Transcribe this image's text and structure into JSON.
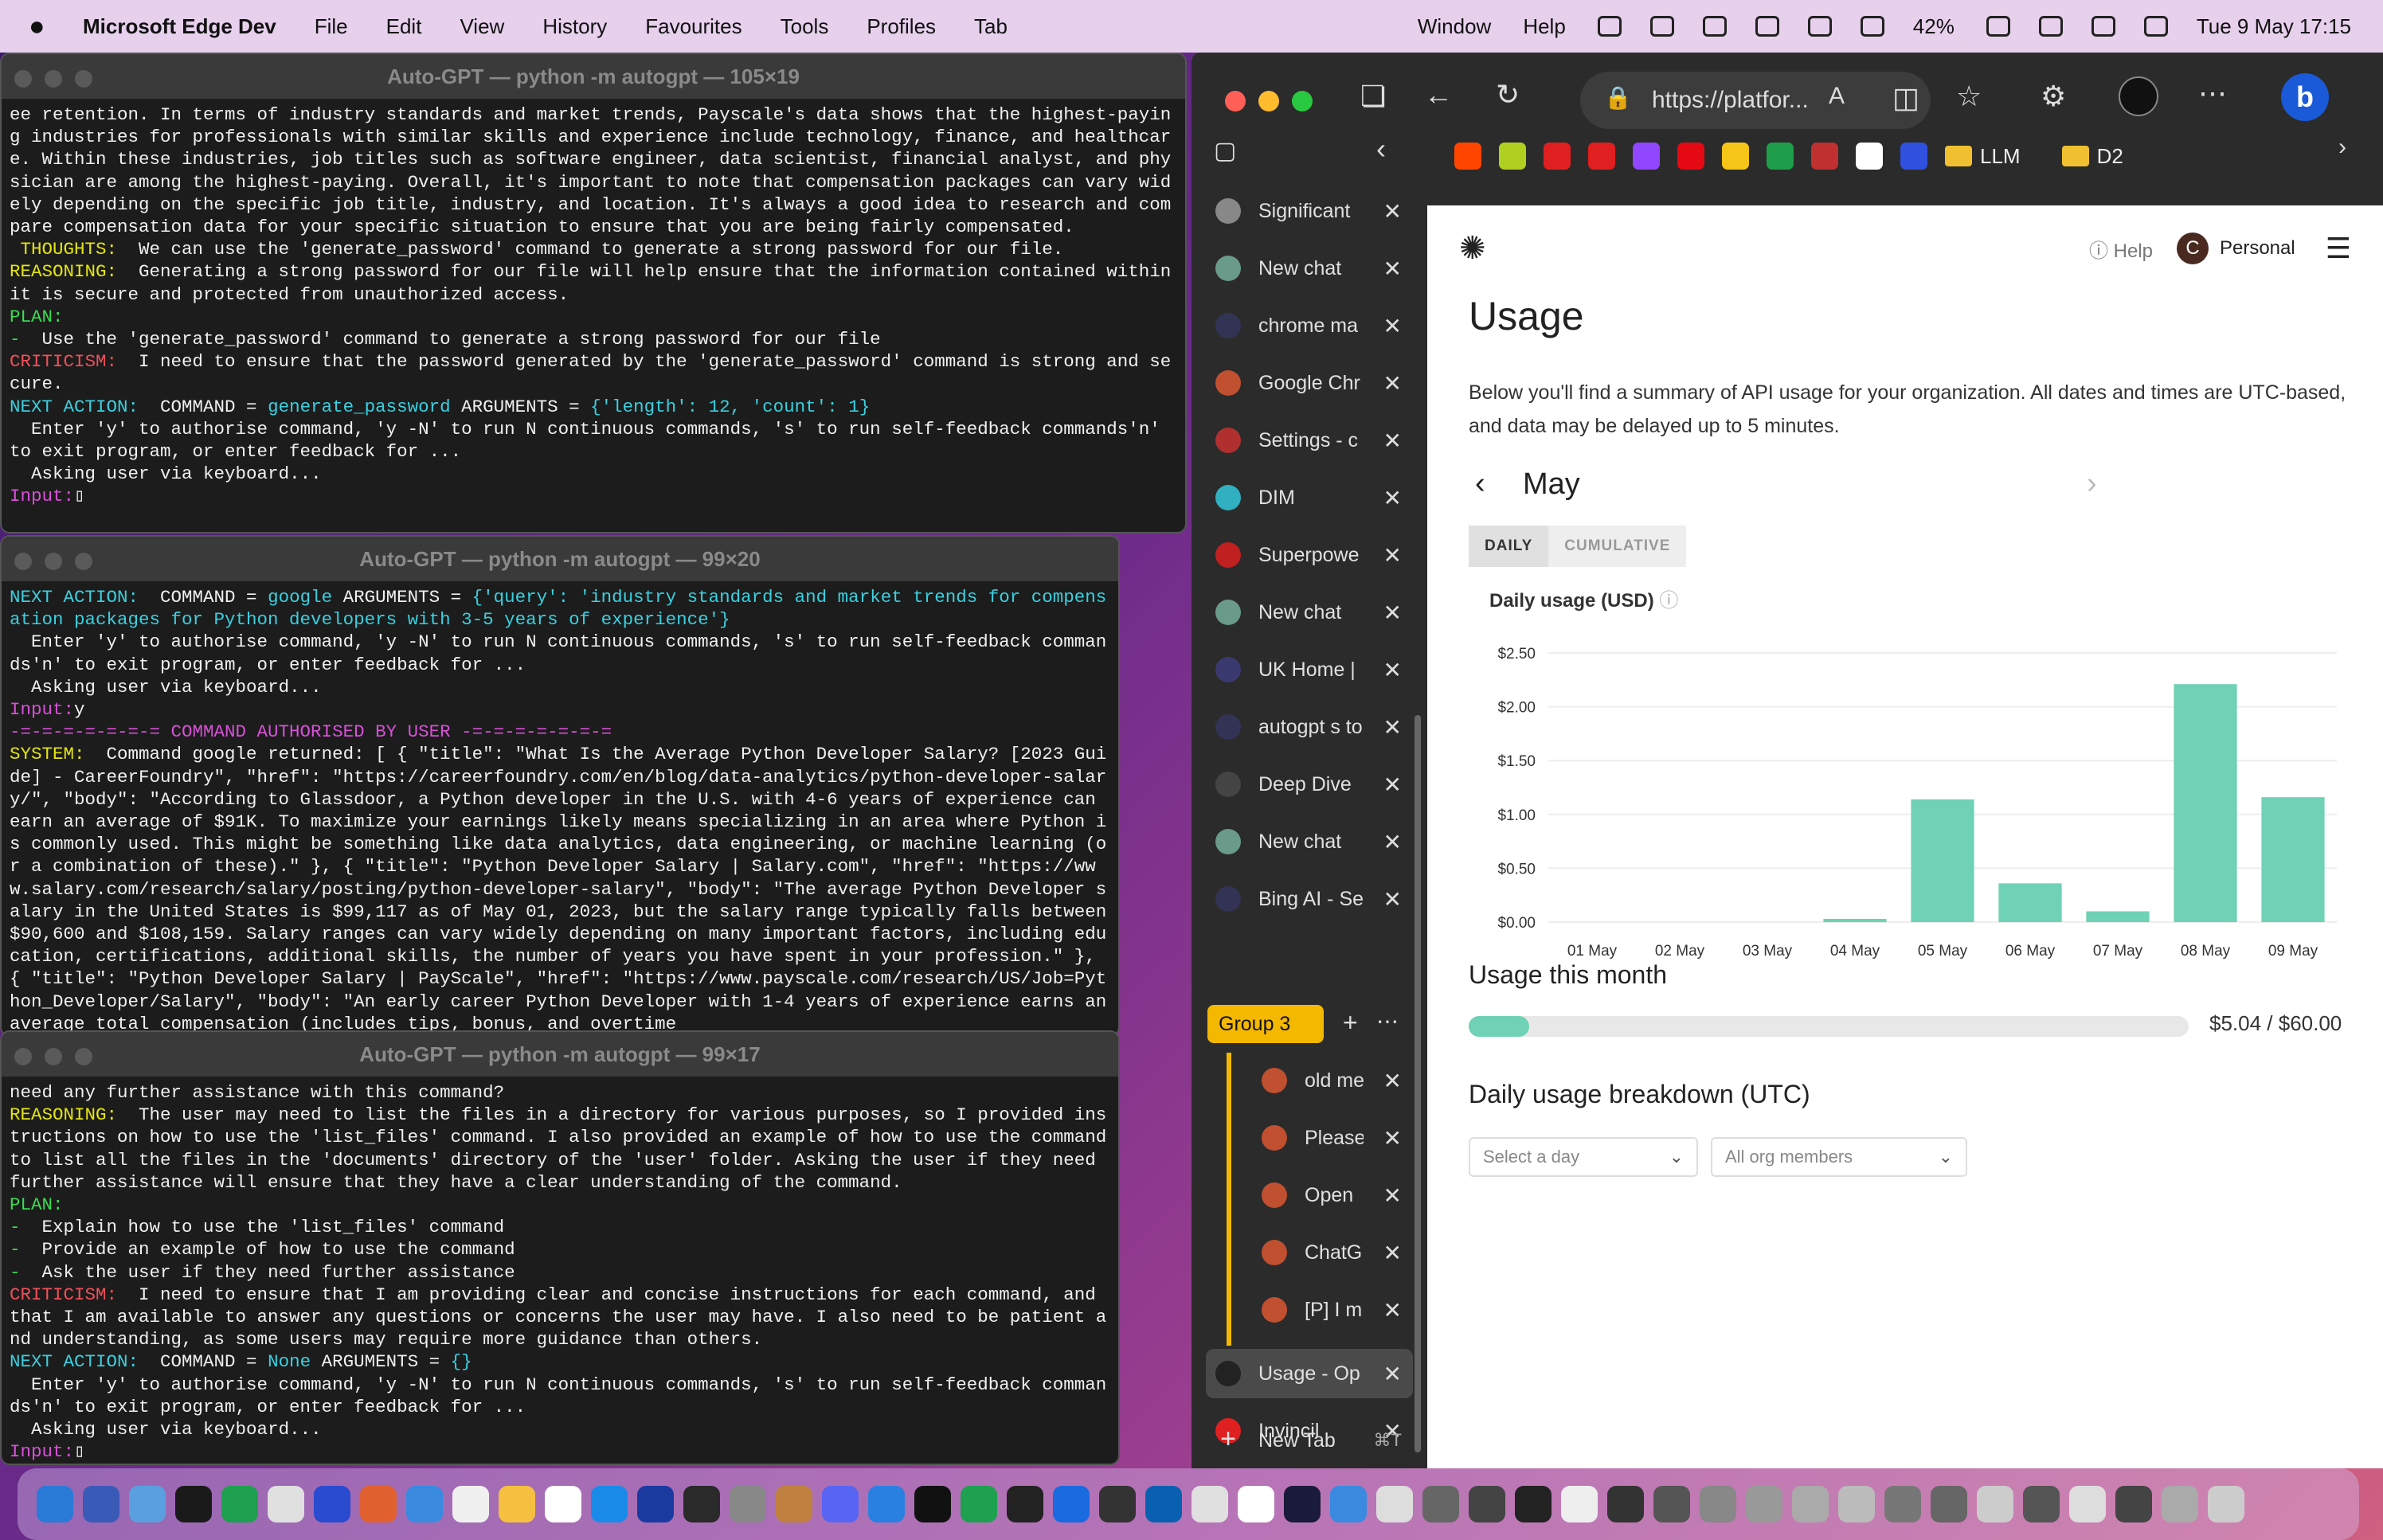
{
  "menubar": {
    "app": "Microsoft Edge Dev",
    "items": [
      "File",
      "Edit",
      "View",
      "History",
      "Favourites",
      "Tools",
      "Profiles",
      "Tab"
    ],
    "right_items": [
      "Window",
      "Help"
    ],
    "battery": "42%",
    "datetime": "Tue 9 May  17:15"
  },
  "term1": {
    "title": "Auto-GPT — python -m autogpt — 105×19",
    "lines": [
      {
        "c": "w",
        "t": "ee retention. In terms of industry standards and market trends, Payscale's data shows that the highest-paying industries for professionals with similar skills and experience include technology, finance, and healthcare. Within these industries, job titles such as software engineer, data scientist, financial analyst, and physician are among the highest-paying. Overall, it's important to note that compensation packages can vary widely depending on the specific job title, industry, and location. It's always a good idea to research and compare compensation data for your specific situation to ensure that you are being fairly compensated."
      },
      {
        "c": "y",
        "t": " THOUGHTS: ",
        "r": " We can use the 'generate_password' command to generate a strong password for our file."
      },
      {
        "c": "y",
        "t": "REASONING: ",
        "r": " Generating a strong password for our file will help ensure that the information contained within it is secure and protected from unauthorized access."
      },
      {
        "c": "g",
        "t": "PLAN:"
      },
      {
        "c": "g",
        "t": "- ",
        "r": " Use the 'generate_password' command to generate a strong password for our file"
      },
      {
        "c": "r",
        "t": "CRITICISM: ",
        "r": " I need to ensure that the password generated by the 'generate_password' command is strong and secure."
      },
      {
        "c": "c",
        "t": "NEXT ACTION: ",
        "r": " COMMAND = ",
        "k": "generate_password",
        "r2": " ARGUMENTS = ",
        "k2": "{'length': 12, 'count': 1}"
      },
      {
        "c": "w",
        "t": "  Enter 'y' to authorise command, 'y -N' to run N continuous commands, 's' to run self-feedback commands'n' to exit program, or enter feedback for ..."
      },
      {
        "c": "w",
        "t": "  Asking user via keyboard..."
      },
      {
        "c": "m",
        "t": "Input:",
        "r": "▯"
      }
    ]
  },
  "term2": {
    "title": "Auto-GPT — python -m autogpt — 99×20",
    "lines": [
      {
        "c": "c",
        "t": "NEXT ACTION: ",
        "r": " COMMAND = ",
        "k": "google",
        "r2": " ARGUMENTS = ",
        "k2": "{'query': 'industry standards and market trends for compensation packages for Python developers with 3-5 years of experience'}"
      },
      {
        "c": "w",
        "t": "  Enter 'y' to authorise command, 'y -N' to run N continuous commands, 's' to run self-feedback commands'n' to exit program, or enter feedback for ..."
      },
      {
        "c": "w",
        "t": "  Asking user via keyboard..."
      },
      {
        "c": "m",
        "t": "Input:",
        "r": "y"
      },
      {
        "c": "m",
        "t": "-=-=-=-=-=-=-= COMMAND AUTHORISED BY USER -=-=-=-=-=-=-="
      },
      {
        "c": "y",
        "t": "SYSTEM: ",
        "r": " Command google returned: [ { \"title\": \"What Is the Average Python Developer Salary? [2023 Guide] - CareerFoundry\", \"href\": \"https://careerfoundry.com/en/blog/data-analytics/python-developer-salary/\", \"body\": \"According to Glassdoor, a Python developer in the U.S. with 4-6 years of experience can earn an average of $91K. To maximize your earnings likely means specializing in an area where Python is commonly used. This might be something like data analytics, data engineering, or machine learning (or a combination of these).\" }, { \"title\": \"Python Developer Salary | Salary.com\", \"href\": \"https://www.salary.com/research/salary/posting/python-developer-salary\", \"body\": \"The average Python Developer salary in the United States is $99,117 as of May 01, 2023, but the salary range typically falls between $90,600 and $108,159. Salary ranges can vary widely depending on many important factors, including education, certifications, additional skills, the number of years you have spent in your profession.\" }, { \"title\": \"Python Developer Salary | PayScale\", \"href\": \"https://www.payscale.com/research/US/Job=Python_Developer/Salary\", \"body\": \"An early career Python Developer with 1-4 years of experience earns an average total compensation (includes tips, bonus, and overtime"
      }
    ]
  },
  "term3": {
    "title": "Auto-GPT — python -m autogpt — 99×17",
    "lines": [
      {
        "c": "w",
        "t": "need any further assistance with this command?"
      },
      {
        "c": "y",
        "t": "REASONING: ",
        "r": " The user may need to list the files in a directory for various purposes, so I provided instructions on how to use the 'list_files' command. I also provided an example of how to use the command to list all the files in the 'documents' directory of the 'user' folder. Asking the user if they need further assistance will ensure that they have a clear understanding of the command."
      },
      {
        "c": "g",
        "t": "PLAN:"
      },
      {
        "c": "g",
        "t": "- ",
        "r": " Explain how to use the 'list_files' command"
      },
      {
        "c": "g",
        "t": "- ",
        "r": " Provide an example of how to use the command"
      },
      {
        "c": "g",
        "t": "- ",
        "r": " Ask the user if they need further assistance"
      },
      {
        "c": "r",
        "t": "CRITICISM: ",
        "r": " I need to ensure that I am providing clear and concise instructions for each command, and that I am available to answer any questions or concerns the user may have. I also need to be patient and understanding, as some users may require more guidance than others."
      },
      {
        "c": "c",
        "t": "NEXT ACTION: ",
        "r": " COMMAND = ",
        "k": "None",
        "r2": " ARGUMENTS = ",
        "k2": "{}"
      },
      {
        "c": "w",
        "t": "  Enter 'y' to authorise command, 'y -N' to run N continuous commands, 's' to run self-feedback commands'n' to exit program, or enter feedback for ..."
      },
      {
        "c": "w",
        "t": "  Asking user via keyboard..."
      },
      {
        "c": "m",
        "t": "Input:",
        "r": "▯"
      }
    ]
  },
  "browser": {
    "url": "https://platfor...",
    "bookmarks": [
      "LLM",
      "D2"
    ],
    "tabs": [
      "Significant",
      "New chat",
      "chrome ma",
      "Google Chr",
      "Settings - c",
      "DIM",
      "Superpowe",
      "New chat",
      "UK Home |",
      "autogpt s to",
      "Deep Dive",
      "New chat",
      "Bing AI - Se"
    ],
    "group_name": "Group 3",
    "group_tabs": [
      "old me",
      "Please",
      "Open",
      "ChatG",
      "[P] I m"
    ],
    "active_tab": "Usage - Op",
    "after_tabs": [
      "Invincil"
    ],
    "new_tab": "New Tab",
    "new_tab_shortcut": "⌘T"
  },
  "page": {
    "help": "Help",
    "avatar": "C",
    "personal": "Personal",
    "title": "Usage",
    "desc": "Below you'll find a summary of API usage for your organization. All dates and times are UTC-based, and data may be delayed up to 5 minutes.",
    "month": "May",
    "seg_daily": "DAILY",
    "seg_cumulative": "CUMULATIVE",
    "chart_label": "Daily usage (USD)",
    "usage_month_title": "Usage this month",
    "usage_value": "$5.04 / $60.00",
    "usage_fraction": 0.084,
    "breakdown_title": "Daily usage breakdown (UTC)",
    "select_day": "Select a day",
    "select_members": "All org members"
  },
  "chart_data": {
    "type": "bar",
    "categories": [
      "01 May",
      "02 May",
      "03 May",
      "04 May",
      "05 May",
      "06 May",
      "07 May",
      "08 May",
      "09 May"
    ],
    "values": [
      0,
      0,
      0,
      0.03,
      1.14,
      0.36,
      0.1,
      2.21,
      1.16
    ],
    "yticks": [
      "$0.00",
      "$0.50",
      "$1.00",
      "$1.50",
      "$2.00",
      "$2.50"
    ],
    "ylim": [
      0,
      2.5
    ],
    "ylabel": "Daily usage (USD)",
    "color": "#6fd1b5"
  },
  "colors": {
    "accent": "#6fd1b5",
    "group": "#f5b800"
  }
}
